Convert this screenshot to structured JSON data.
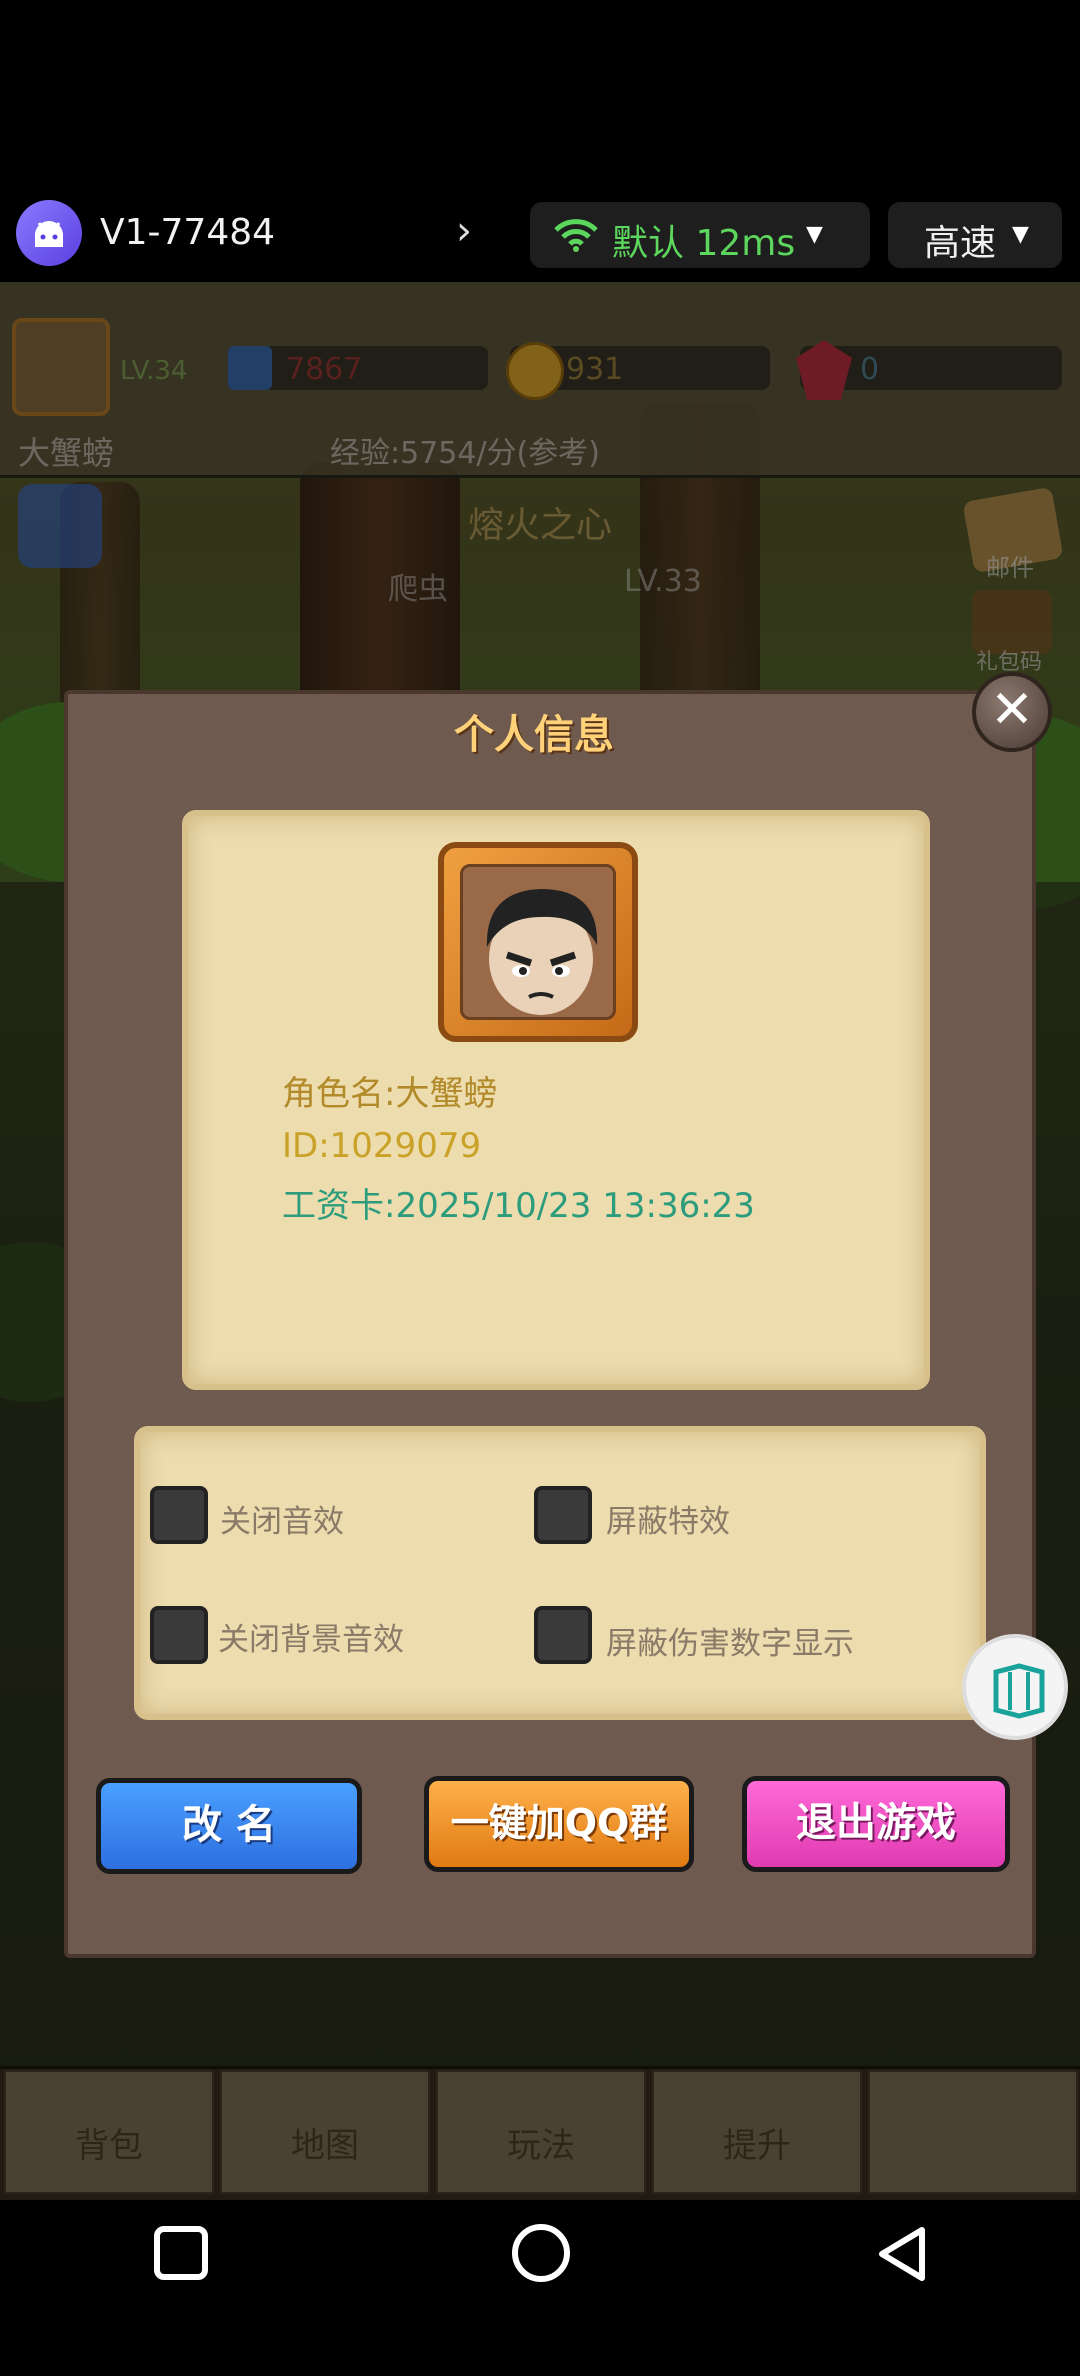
{
  "topbar": {
    "device_name": "V1-77484",
    "network_label": "默认 12ms",
    "speed_label": "高速",
    "colors": {
      "network": "#5cd65c"
    }
  },
  "game_hud": {
    "level": "LV.34",
    "power": "7867",
    "gold": "931",
    "gems": "0",
    "player_name": "大蟹螃",
    "exp_rate": "经验:5754/分(参考)",
    "stage_name": "熔火之心",
    "enemy_name": "爬虫",
    "enemy_level": "LV.33",
    "mail_label": "邮件",
    "gift_label": "礼包码"
  },
  "modal": {
    "title": "个人信息",
    "role_name": "角色名:大蟹螃",
    "role_id": "ID:1029079",
    "salary_card": "工资卡:2025/10/23 13:36:23",
    "settings": [
      {
        "label": "关闭音效",
        "checked": false
      },
      {
        "label": "屏蔽特效",
        "checked": false
      },
      {
        "label": "关闭背景音效",
        "checked": false
      },
      {
        "label": "屏蔽伤害数字显示",
        "checked": false
      }
    ],
    "buttons": {
      "rename": "改 名",
      "qq_group": "一键加QQ群",
      "exit": "退出游戏"
    },
    "colors": {
      "title": "#ffd27a",
      "salary": "#2c9c7c"
    }
  },
  "bottom_nav": [
    "背包",
    "地图",
    "玩法",
    "提升"
  ]
}
